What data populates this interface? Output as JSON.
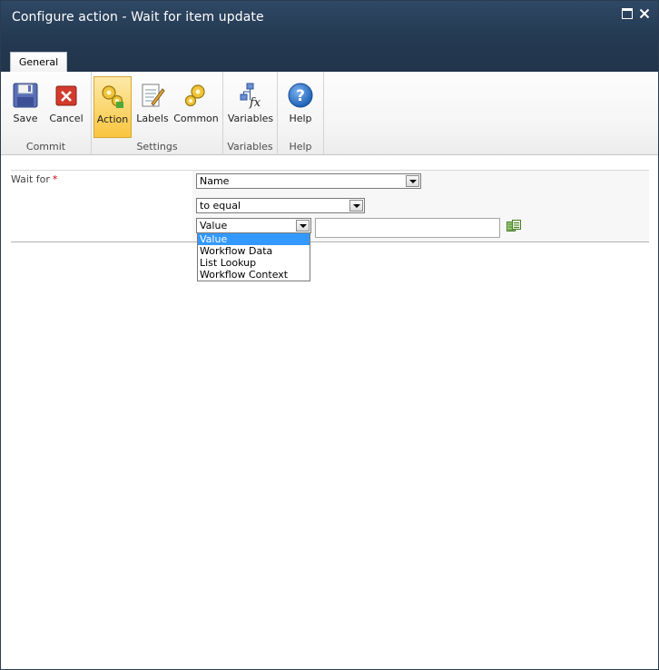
{
  "window": {
    "title": "Configure action - Wait for item update"
  },
  "tabs": {
    "general": "General"
  },
  "ribbon": {
    "commit": {
      "label": "Commit",
      "save": "Save",
      "cancel": "Cancel"
    },
    "settings": {
      "label": "Settings",
      "action": "Action",
      "labels": "Labels",
      "common": "Common"
    },
    "variables": {
      "label": "Variables",
      "variables": "Variables"
    },
    "help": {
      "label": "Help",
      "help": "Help"
    }
  },
  "form": {
    "wait_for_label": "Wait for",
    "required_marker": "*",
    "field_select": "Name",
    "operator_select": "to equal",
    "value_type_select": "Value",
    "value_input": "",
    "value_type_options": [
      "Value",
      "Workflow Data",
      "List Lookup",
      "Workflow Context"
    ],
    "selected_option": "Value"
  },
  "colors": {
    "title_bar": "#243a52",
    "selected_button": "#fbd468",
    "dropdown_highlight": "#3399ff",
    "required": "#cc0000"
  }
}
